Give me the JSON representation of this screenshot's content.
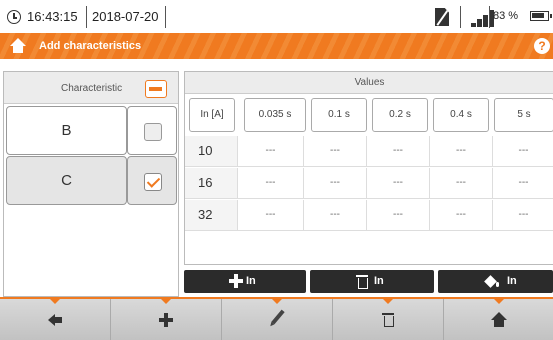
{
  "status": {
    "time": "16:43:15",
    "date": "2018-07-20",
    "battery": "83 %"
  },
  "header": {
    "title": "Add characteristics",
    "help": "?"
  },
  "characteristics": {
    "header_label": "Characteristic",
    "rows": [
      {
        "name": "B",
        "checked": false
      },
      {
        "name": "C",
        "checked": true
      }
    ]
  },
  "values": {
    "title": "Values",
    "columns": [
      "In [A]",
      "0.035 s",
      "0.1 s",
      "0.2 s",
      "0.4 s",
      "5 s"
    ],
    "rows": [
      {
        "in": "10",
        "cells": [
          "---",
          "---",
          "---",
          "---",
          "---"
        ]
      },
      {
        "in": "16",
        "cells": [
          "---",
          "---",
          "---",
          "---",
          "---"
        ]
      },
      {
        "in": "32",
        "cells": [
          "---",
          "---",
          "---",
          "---",
          "---"
        ]
      }
    ]
  },
  "actions": {
    "add_in": "In",
    "delete_in": "In",
    "fill_in": "In"
  },
  "toolbar": {
    "icons": [
      "back-arrow-icon",
      "plus-icon",
      "pencil-icon",
      "trash-icon",
      "home-icon"
    ]
  },
  "colors": {
    "accent": "#f07a20",
    "toolbar": "#c8c8c8",
    "dark_button": "#2b2b2b"
  }
}
